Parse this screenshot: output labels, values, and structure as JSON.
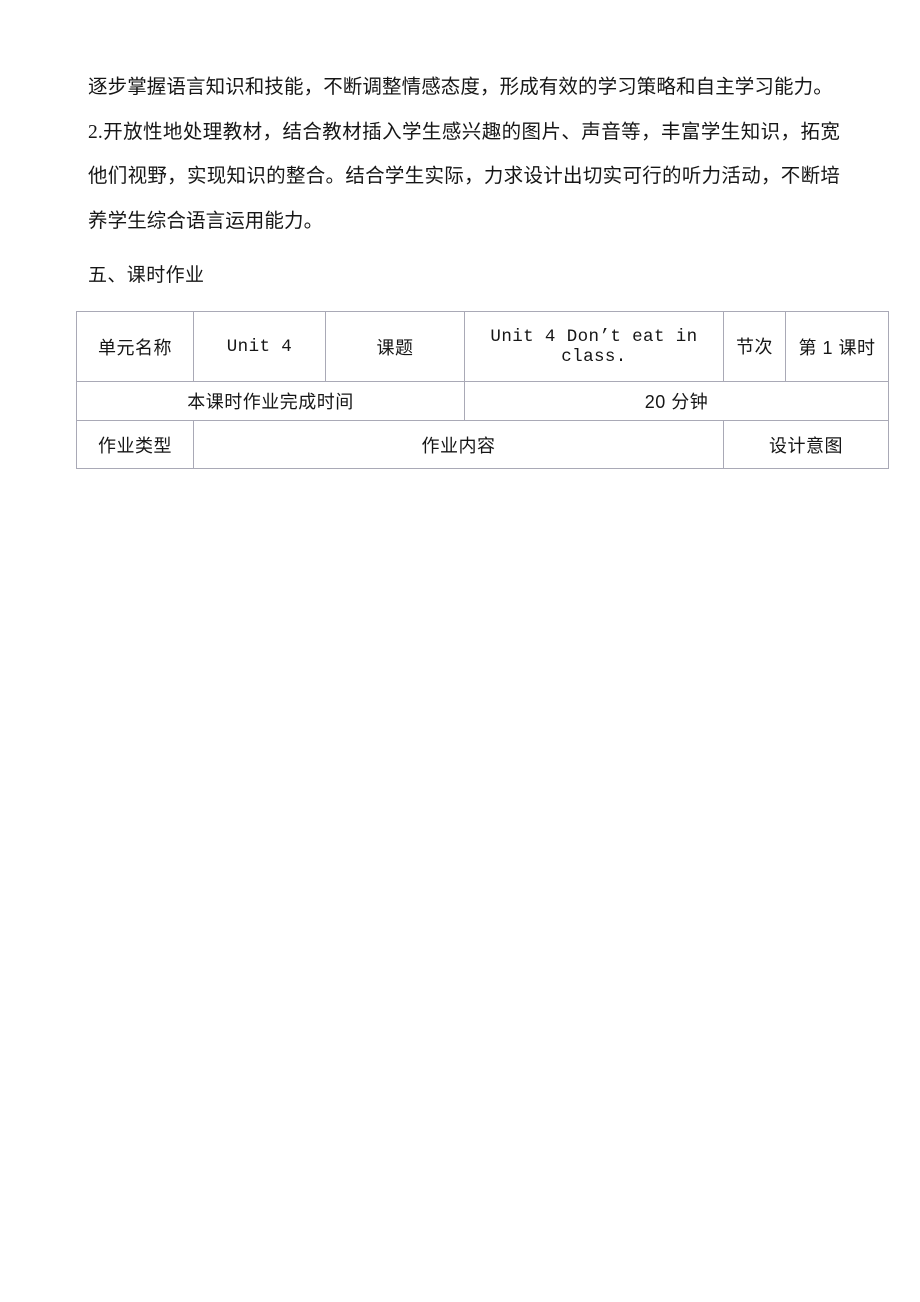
{
  "document": {
    "paragraphs": [
      "逐步掌握语言知识和技能，不断调整情感态度，形成有效的学习策略和自主学习能力。",
      "2.开放性地处理教材，结合教材插入学生感兴趣的图片、声音等，丰富学生知识，拓宽他们视野，实现知识的整合。结合学生实际，力求设计出切实可行的听力活动，不断培养学生综合语言运用能力。"
    ],
    "section_heading": "五、课时作业"
  },
  "homework_table": {
    "rows": [
      {
        "unit_name_label": "单元名称",
        "unit_name_value": "Unit 4",
        "topic_label": "课题",
        "topic_value": "Unit 4 Don’t eat in class.",
        "period_label": "节次",
        "period_value": "第 1 课时"
      },
      {
        "duration_label": "本课时作业完成时间",
        "duration_value": "20 分钟"
      },
      {
        "type_label": "作业类型",
        "content_label": "作业内容",
        "intent_label": "设计意图"
      }
    ]
  },
  "colors": {
    "text": "#161616",
    "border": "#a9a9b6",
    "background": "#ffffff"
  }
}
